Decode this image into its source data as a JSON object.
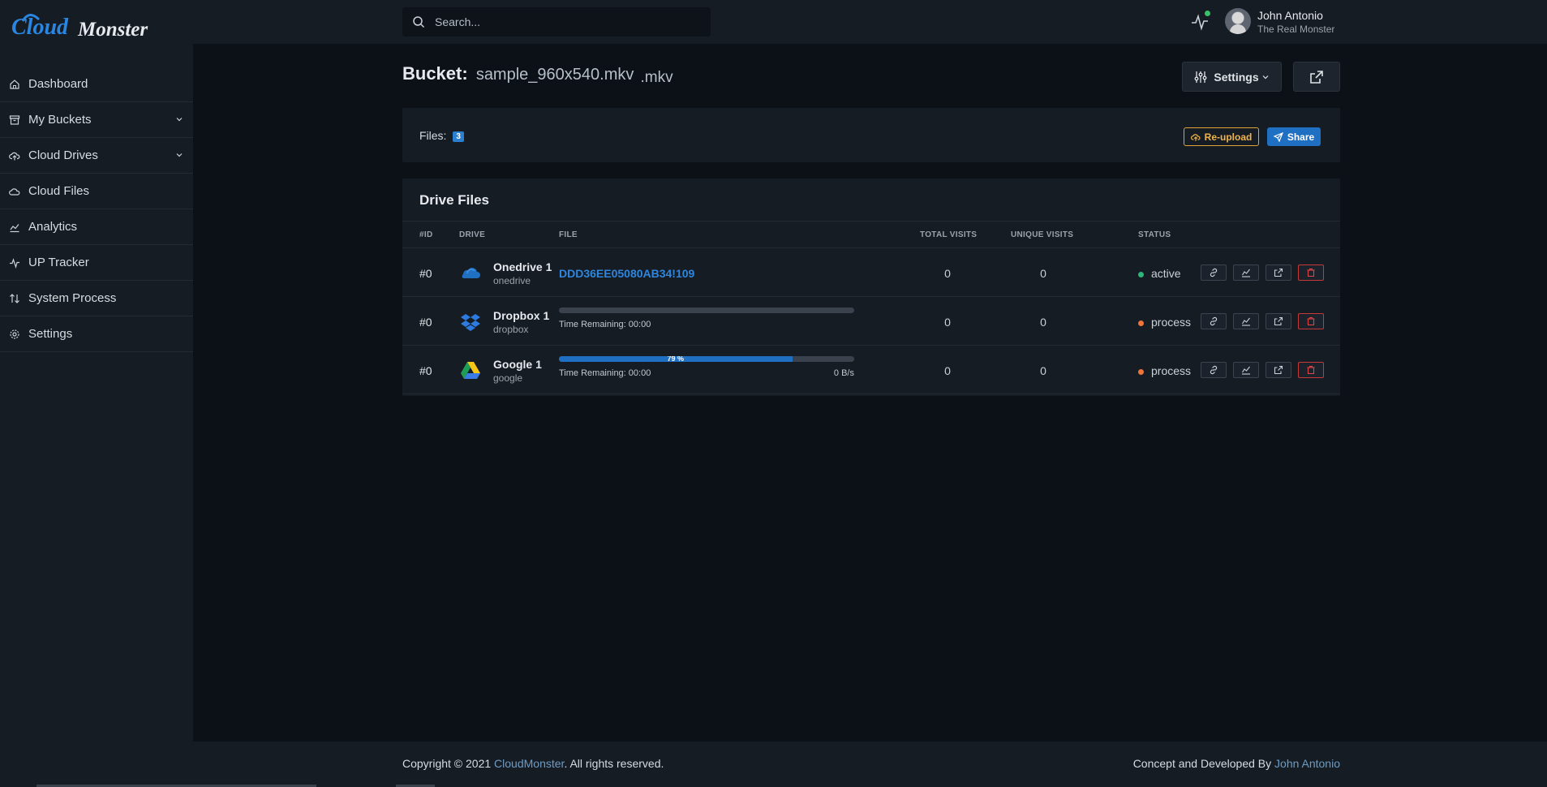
{
  "app": {
    "logo_part1": "Cloud",
    "logo_part2": "Monster"
  },
  "search": {
    "placeholder": "Search..."
  },
  "user": {
    "name": "John Antonio",
    "subtitle": "The Real Monster"
  },
  "sidebar": {
    "items": [
      {
        "label": "Dashboard",
        "icon": "home-icon"
      },
      {
        "label": "My Buckets",
        "icon": "archive-icon",
        "expandable": true
      },
      {
        "label": "Cloud Drives",
        "icon": "cloud-upload-icon",
        "expandable": true
      },
      {
        "label": "Cloud Files",
        "icon": "cloud-icon"
      },
      {
        "label": "Analytics",
        "icon": "chart-icon"
      },
      {
        "label": "UP Tracker",
        "icon": "activity-icon"
      },
      {
        "label": "System Process",
        "icon": "arrows-updown-icon"
      },
      {
        "label": "Settings",
        "icon": "gear-icon"
      }
    ]
  },
  "header": {
    "title_label": "Bucket:",
    "bucket_name": "sample_960x540.mkv",
    "extension": ".mkv",
    "settings_label": "Settings"
  },
  "files_card": {
    "label": "Files:",
    "count": "3",
    "reupload_label": "Re-upload",
    "share_label": "Share"
  },
  "table": {
    "title": "Drive Files",
    "columns": [
      "#ID",
      "DRIVE",
      "FILE",
      "TOTAL VISITS",
      "UNIQUE VISITS",
      "STATUS"
    ],
    "rows": [
      {
        "id": "#0",
        "drive": "Onedrive 1",
        "type": "onedrive",
        "file": "DDD36EE05080AB34!109",
        "total_visits": "0",
        "unique_visits": "0",
        "status": "active",
        "status_color": "#2fb57a"
      },
      {
        "id": "#0",
        "drive": "Dropbox 1",
        "type": "dropbox",
        "progress": 0,
        "time_remaining": "Time Remaining: 00:00",
        "total_visits": "0",
        "unique_visits": "0",
        "status": "process",
        "status_color": "#f0743a"
      },
      {
        "id": "#0",
        "drive": "Google 1",
        "type": "google",
        "progress": 79,
        "progress_label": "79 %",
        "time_remaining": "Time Remaining: 00:00",
        "speed": "0 B/s",
        "total_visits": "0",
        "unique_visits": "0",
        "status": "process",
        "status_color": "#f0743a"
      }
    ]
  },
  "footer": {
    "copy_prefix": "Copyright © 2021 ",
    "copy_link": "CloudMonster",
    "copy_suffix": ". All rights reserved.",
    "concept_prefix": "Concept and Developed By ",
    "concept_link": "John Antonio"
  },
  "colors": {
    "accent": "#1f6fc3",
    "warning": "#e0a237",
    "danger": "#c43a3a",
    "background": "#0c1118",
    "panel": "#161c24"
  }
}
